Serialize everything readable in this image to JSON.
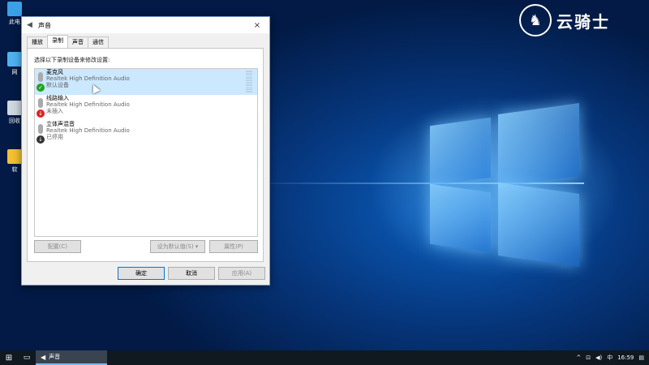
{
  "desktop": {
    "icons": [
      {
        "label": "此电",
        "icon": "this-pc-icon"
      },
      {
        "label": "网",
        "icon": "network-icon"
      },
      {
        "label": "回收",
        "icon": "recycle-bin-icon"
      },
      {
        "label": "软",
        "icon": "software-icon"
      }
    ]
  },
  "watermark": {
    "glyph": "♞",
    "text": "云骑士"
  },
  "dialog": {
    "title": "声音",
    "close": "×",
    "tabs": [
      {
        "label": "播放"
      },
      {
        "label": "录制"
      },
      {
        "label": "声音"
      },
      {
        "label": "通信"
      }
    ],
    "active_tab": "录制",
    "instruction": "选择以下录制设备来修改设置:",
    "devices": [
      {
        "name": "麦克风",
        "description": "Realtek High Definition Audio",
        "state": "默认设备",
        "status_icon": "check-icon",
        "status_glyph": "✓",
        "selected": true
      },
      {
        "name": "线路输入",
        "description": "Realtek High Definition Audio",
        "state": "未插入",
        "status_icon": "arrow-down-red-icon",
        "status_glyph": "↓",
        "selected": false
      },
      {
        "name": "立体声混音",
        "description": "Realtek High Definition Audio",
        "state": "已停用",
        "status_icon": "arrow-down-black-icon",
        "status_glyph": "↓",
        "selected": false
      }
    ],
    "buttons": {
      "configure": "配置(C)",
      "set_default": "设为默认值(S) ▾",
      "properties": "属性(P)",
      "ok": "确定",
      "cancel": "取消",
      "apply": "应用(A)"
    }
  },
  "taskbar": {
    "start_glyph": "⊞",
    "taskview_glyph": "▭",
    "open_window": "声音",
    "speaker_glyph": "◀",
    "tray": {
      "chevron": "^",
      "network": "⊡",
      "volume": "◀)",
      "ime": "中",
      "time": "16:59",
      "notification": "▤"
    }
  }
}
